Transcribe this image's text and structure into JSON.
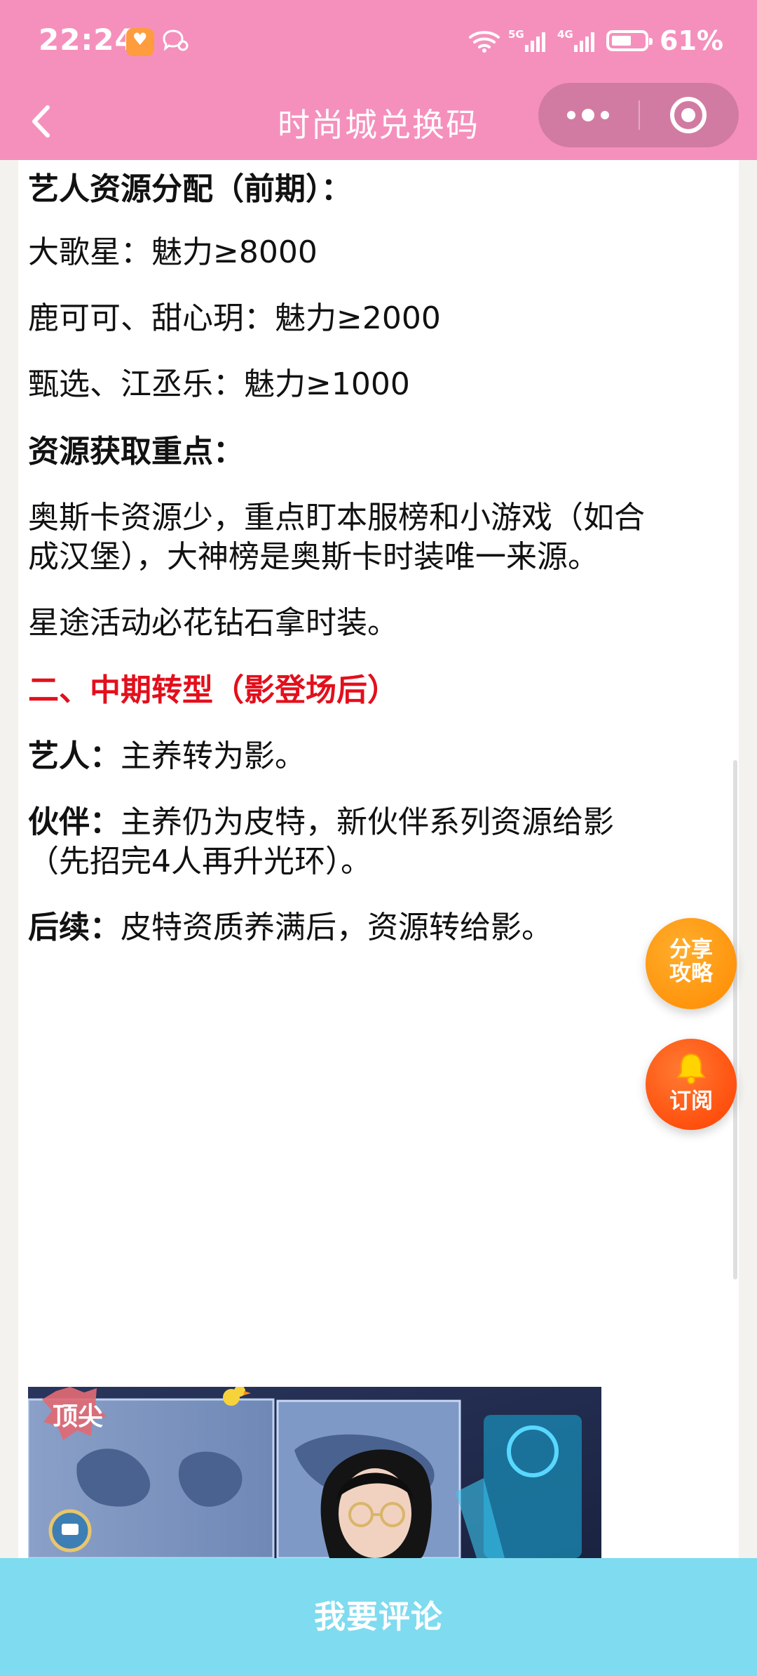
{
  "status_bar": {
    "time": "22:24",
    "signal_5g": "5G",
    "signal_4g": "4G",
    "battery_percent": "61%",
    "battery_level": 0.61
  },
  "header": {
    "title": "时尚城兑换码"
  },
  "article": {
    "lines": [
      {
        "label": "艺人资源分配（前期）：",
        "text": ""
      },
      {
        "label": "",
        "text": "大歌星：魅力≥8000"
      },
      {
        "label": "",
        "text": "鹿可可、甜心玥：魅力≥2000"
      },
      {
        "label": "",
        "text": "甄选、江丞乐：魅力≥1000"
      },
      {
        "label": "资源获取重点：",
        "text": ""
      },
      {
        "label": "",
        "text": "奥斯卡资源少，重点盯本服榜和小游戏（如合"
      },
      {
        "label": "",
        "text": "成汉堡），大神榜是奥斯卡时装唯一来源。"
      },
      {
        "label": "",
        "text": "星途活动必花钻石拿时装。"
      },
      {
        "label": "二、中期转型（影登场后）",
        "text": ""
      },
      {
        "label": "艺人：",
        "text": "主养转为影。"
      },
      {
        "label": "伙伴：",
        "text": "主养仍为皮特，新伙伴系列资源给影"
      },
      {
        "label": "",
        "text": "（先招完4人再升光环）。"
      },
      {
        "label": "后续：",
        "text": "皮特资质养满后，资源转给影。"
      }
    ],
    "image_badge": "顶尖"
  },
  "floating": {
    "share_line1": "分享",
    "share_line2": "攻略",
    "subscribe": "订阅"
  },
  "bottom_bar": {
    "comment": "我要评论"
  },
  "colors": {
    "header_pink": "#f590bd",
    "section_red": "#e30f1c",
    "share_orange": "#ff8a00",
    "subscribe_orange": "#ff3e00",
    "comment_bar": "#7fdbef"
  }
}
